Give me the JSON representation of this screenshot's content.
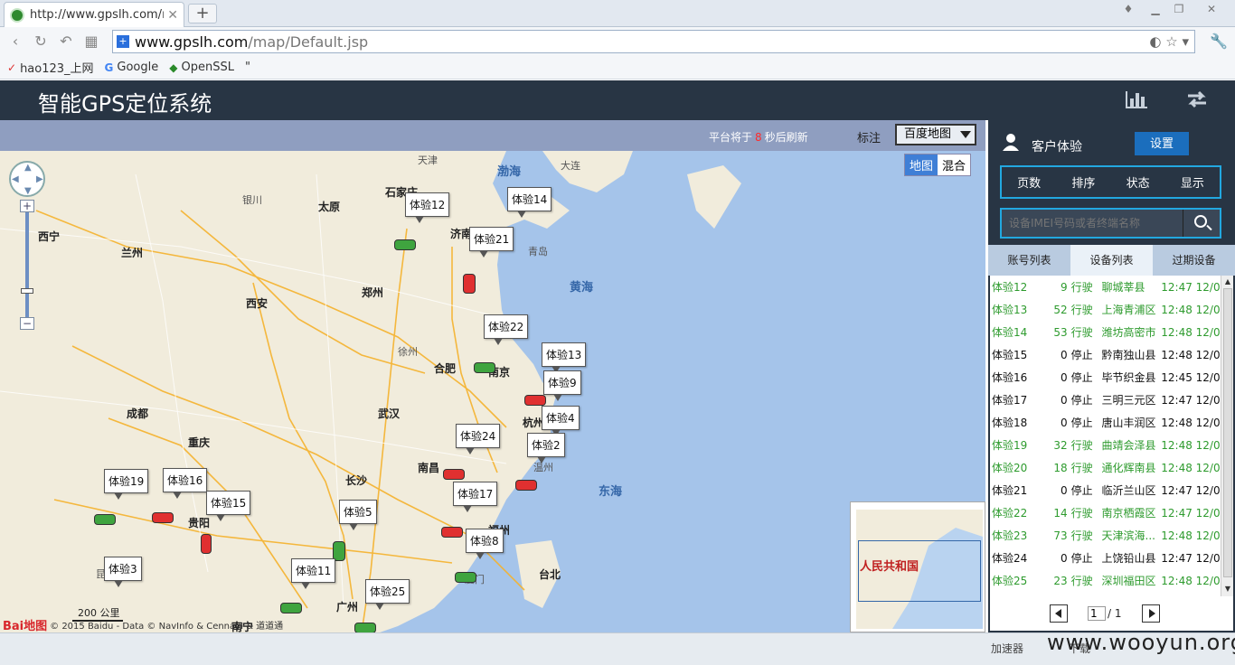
{
  "browser": {
    "tab_title": "http://www.gpslh.com/ma",
    "new_tab": "+",
    "url_host": "www.gpslh.com",
    "url_path": "/map/Default.jsp",
    "bookmarks": [
      {
        "label": "hao123_上网",
        "icon": "hao"
      },
      {
        "label": "Google",
        "icon": "G"
      },
      {
        "label": "OpenSSL",
        "icon": "shield"
      },
      {
        "label": "\"",
        "icon": ""
      }
    ]
  },
  "app": {
    "title": "智能GPS定位系统"
  },
  "map": {
    "refresh_prefix": "平台将于",
    "refresh_seconds": "8",
    "refresh_suffix": "秒后刷新",
    "label_text": "标注",
    "map_provider": "百度地图",
    "map_btn": "地图",
    "hybrid_btn": "混合",
    "scale": "200 公里",
    "copyright": "© 2015 Baidu - Data © NavInfo & CennavI & 道道通",
    "baidu_logo": "Bai地图",
    "minimap_label": "人民共和国",
    "sea_labels": {
      "bohai": "渤海",
      "yellow": "黄海",
      "east": "东海"
    },
    "vehicles": [
      {
        "name": "体验12",
        "color": "green"
      },
      {
        "name": "体验14",
        "color": "green"
      },
      {
        "name": "体验21",
        "color": "red"
      },
      {
        "name": "体验22",
        "color": "green"
      },
      {
        "name": "体验13",
        "color": "green"
      },
      {
        "name": "体验9",
        "color": "red"
      },
      {
        "name": "体验4",
        "color": "red"
      },
      {
        "name": "体验2",
        "color": "green"
      },
      {
        "name": "体验24",
        "color": "red"
      },
      {
        "name": "体验17",
        "color": "red"
      },
      {
        "name": "体验8",
        "color": "green"
      },
      {
        "name": "体验5",
        "color": "green"
      },
      {
        "name": "体验11",
        "color": "green"
      },
      {
        "name": "体验25",
        "color": "green"
      },
      {
        "name": "体验19",
        "color": "green"
      },
      {
        "name": "体验16",
        "color": "red"
      },
      {
        "name": "体验15",
        "color": "red"
      },
      {
        "name": "体验3",
        "color": "green"
      }
    ],
    "cities": [
      "石家庄",
      "太原",
      "济南",
      "青岛",
      "郑州",
      "西安",
      "合肥",
      "南京",
      "杭州",
      "武汉",
      "南昌",
      "长沙",
      "福州",
      "成都",
      "重庆",
      "贵阳",
      "广州",
      "台北",
      "兰州",
      "西宁",
      "银川",
      "天津",
      "大连",
      "徐州",
      "宁波",
      "温州",
      "厦门",
      "南宁",
      "昆明"
    ]
  },
  "sidebar": {
    "user_name": "客户体验",
    "settings": "设置",
    "menu": [
      "页数",
      "排序",
      "状态",
      "显示"
    ],
    "search_placeholder": "设备IMEI号码或者终端名称",
    "tabs": [
      "账号列表",
      "设备列表",
      "过期设备"
    ],
    "devices": [
      {
        "name": "体验12",
        "speed": "9",
        "status": "行驶",
        "location": "聊城莘县",
        "time": "12:47 12/0",
        "color": "green"
      },
      {
        "name": "体验13",
        "speed": "52",
        "status": "行驶",
        "location": "上海青浦区",
        "time": "12:48 12/0",
        "color": "green"
      },
      {
        "name": "体验14",
        "speed": "53",
        "status": "行驶",
        "location": "潍坊高密市",
        "time": "12:48 12/0",
        "color": "green"
      },
      {
        "name": "体验15",
        "speed": "0",
        "status": "停止",
        "location": "黔南独山县",
        "time": "12:48 12/0",
        "color": "black"
      },
      {
        "name": "体验16",
        "speed": "0",
        "status": "停止",
        "location": "毕节织金县",
        "time": "12:45 12/0",
        "color": "black"
      },
      {
        "name": "体验17",
        "speed": "0",
        "status": "停止",
        "location": "三明三元区",
        "time": "12:47 12/0",
        "color": "black"
      },
      {
        "name": "体验18",
        "speed": "0",
        "status": "停止",
        "location": "唐山丰润区",
        "time": "12:48 12/0",
        "color": "black"
      },
      {
        "name": "体验19",
        "speed": "32",
        "status": "行驶",
        "location": "曲靖会泽县",
        "time": "12:48 12/0",
        "color": "green"
      },
      {
        "name": "体验20",
        "speed": "18",
        "status": "行驶",
        "location": "通化辉南县",
        "time": "12:48 12/0",
        "color": "green"
      },
      {
        "name": "体验21",
        "speed": "0",
        "status": "停止",
        "location": "临沂兰山区",
        "time": "12:47 12/0",
        "color": "black"
      },
      {
        "name": "体验22",
        "speed": "14",
        "status": "行驶",
        "location": "南京栖霞区",
        "time": "12:47 12/0",
        "color": "green"
      },
      {
        "name": "体验23",
        "speed": "73",
        "status": "行驶",
        "location": "天津滨海...",
        "time": "12:48 12/0",
        "color": "green"
      },
      {
        "name": "体验24",
        "speed": "0",
        "status": "停止",
        "location": "上饶铅山县",
        "time": "12:47 12/0",
        "color": "black"
      },
      {
        "name": "体验25",
        "speed": "23",
        "status": "行驶",
        "location": "深圳福田区",
        "time": "12:48 12/0",
        "color": "green"
      }
    ],
    "pager": {
      "current": "1",
      "total": "/ 1"
    }
  },
  "statusbar": {
    "accelerator": "加速器",
    "download": "下载",
    "watermark": "www.wooyun.org"
  }
}
